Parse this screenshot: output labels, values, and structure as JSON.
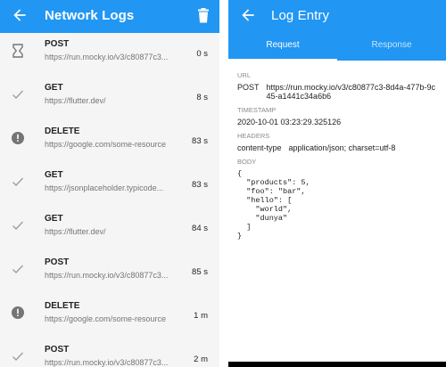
{
  "left": {
    "title": "Network Logs",
    "rows": [
      {
        "status": "pending",
        "method": "POST",
        "url": "https://run.mocky.io/v3/c80877c3...",
        "time": "0 s"
      },
      {
        "status": "success",
        "method": "GET",
        "url": "https://flutter.dev/",
        "time": "8 s"
      },
      {
        "status": "error",
        "method": "DELETE",
        "url": "https://google.com/some-resource",
        "time": "83 s"
      },
      {
        "status": "success",
        "method": "GET",
        "url": "https://jsonplaceholder.typicode...",
        "time": "83 s"
      },
      {
        "status": "success",
        "method": "GET",
        "url": "https://flutter.dev/",
        "time": "84 s"
      },
      {
        "status": "success",
        "method": "POST",
        "url": "https://run.mocky.io/v3/c80877c3...",
        "time": "85 s"
      },
      {
        "status": "error",
        "method": "DELETE",
        "url": "https://google.com/some-resource",
        "time": "1 m"
      },
      {
        "status": "success",
        "method": "POST",
        "url": "https://run.mocky.io/v3/c80877c3...",
        "time": "2 m"
      }
    ]
  },
  "right": {
    "title": "Log Entry",
    "tabs": [
      "Request",
      "Response"
    ],
    "url_label": "URL",
    "method": "POST",
    "url": "https://run.mocky.io/v3/c80877c3-8d4a-477b-9c45-a1441c34a6b6",
    "timestamp_label": "TIMESTAMP",
    "timestamp": "2020-10-01 03:23:29.325126",
    "headers_label": "HEADERS",
    "header_key": "content-type",
    "header_value": "application/json; charset=utf-8",
    "body_label": "BODY",
    "body": "{\n  \"products\": 5,\n  \"foo\": \"bar\",\n  \"hello\": [\n    \"world\",\n    \"dunya\"\n  ]\n}"
  },
  "colors": {
    "primary": "#2196f3",
    "error_icon": "#757575",
    "check_icon": "#9e9e9e"
  }
}
